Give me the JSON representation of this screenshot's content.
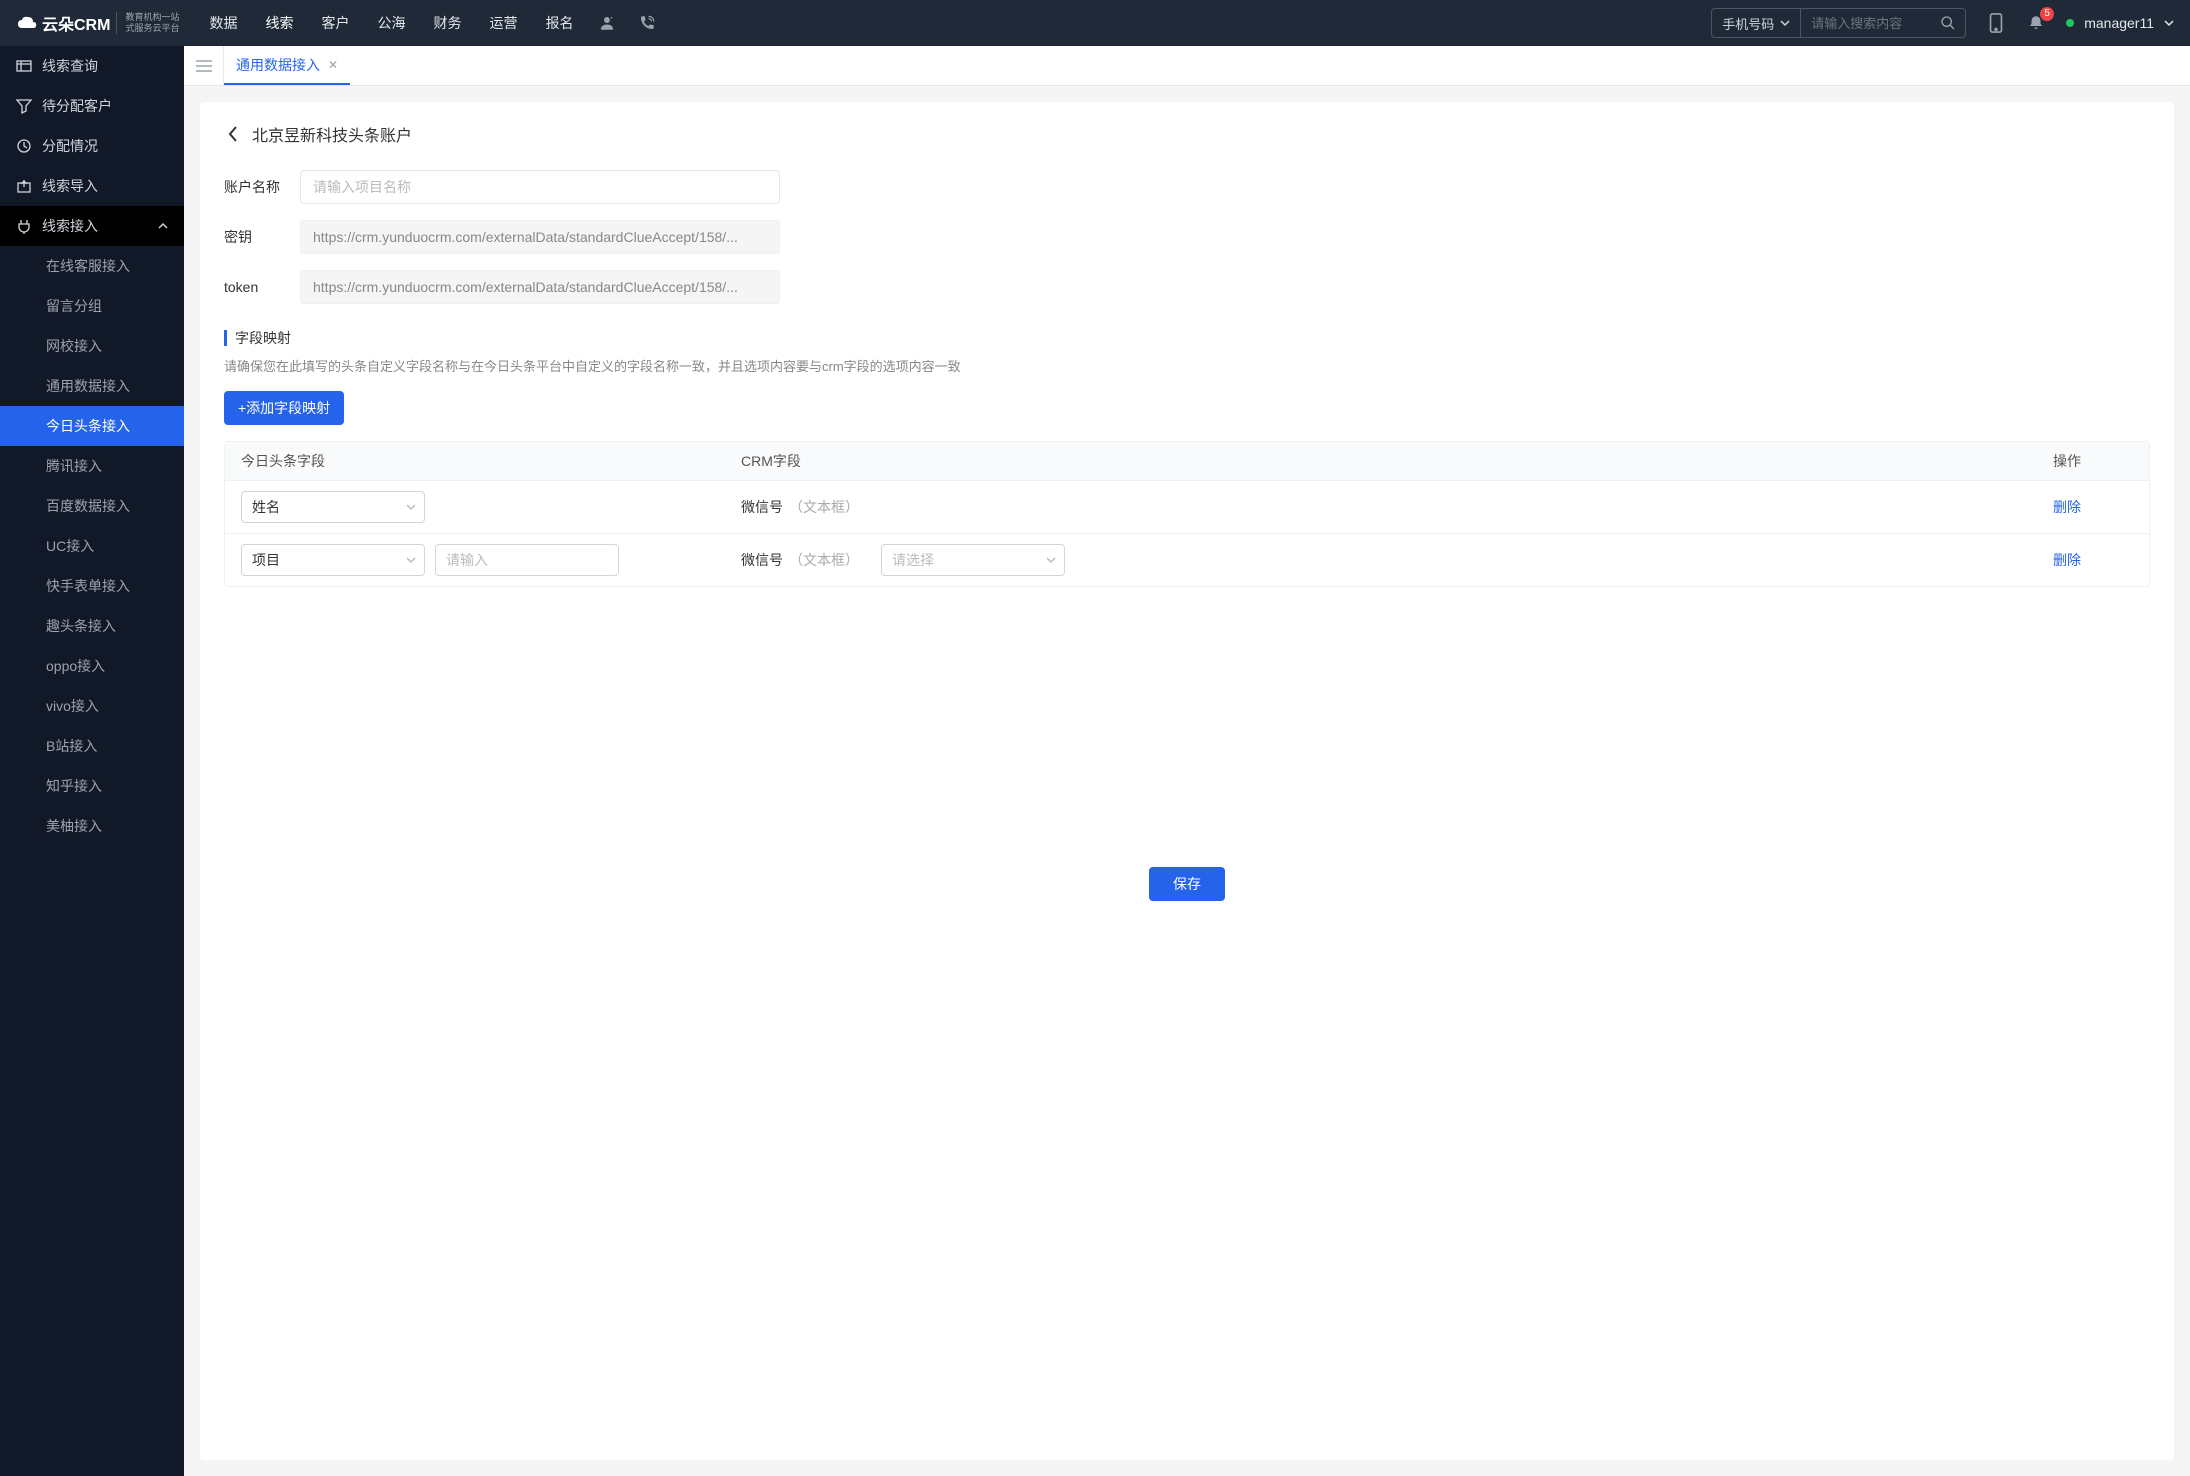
{
  "logo": {
    "brand": "云朵CRM",
    "sub_url": "www.yunduocrm.com",
    "sub1": "教育机构一站",
    "sub2": "式服务云平台"
  },
  "nav": [
    "数据",
    "线索",
    "客户",
    "公海",
    "财务",
    "运营",
    "报名"
  ],
  "nav_active": "线索",
  "search": {
    "type": "手机号码",
    "placeholder": "请输入搜索内容"
  },
  "notifications_badge": "5",
  "user": {
    "name": "manager11"
  },
  "sidebar": {
    "top": [
      {
        "label": "线索查询"
      },
      {
        "label": "待分配客户"
      },
      {
        "label": "分配情况"
      },
      {
        "label": "线索导入"
      }
    ],
    "integration": {
      "label": "线索接入",
      "items": [
        "在线客服接入",
        "留言分组",
        "网校接入",
        "通用数据接入",
        "今日头条接入",
        "腾讯接入",
        "百度数据接入",
        "UC接入",
        "快手表单接入",
        "趣头条接入",
        "oppo接入",
        "vivo接入",
        "B站接入",
        "知乎接入",
        "美柚接入"
      ],
      "active": "今日头条接入"
    }
  },
  "tabs": [
    {
      "label": "通用数据接入"
    }
  ],
  "page": {
    "title": "北京昱新科技头条账户",
    "form": {
      "account_label": "账户名称",
      "account_placeholder": "请输入项目名称",
      "account_value": "",
      "secret_label": "密钥",
      "secret_value": "https://crm.yunduocrm.com/externalData/standardClueAccept/158/...",
      "token_label": "token",
      "token_value": "https://crm.yunduocrm.com/externalData/standardClueAccept/158/..."
    },
    "mapping": {
      "title": "字段映射",
      "hint": "请确保您在此填写的头条自定义字段名称与在今日头条平台中自定义的字段名称一致，并且选项内容要与crm字段的选项内容一致",
      "add_btn": "+添加字段映射",
      "headers": {
        "h1": "今日头条字段",
        "h2": "CRM字段",
        "h3": "操作"
      },
      "rows": [
        {
          "tt_field": "姓名",
          "extra_input": false,
          "crm_main": "微信号",
          "crm_sub": "（文本框）",
          "crm_select": false,
          "del": "删除"
        },
        {
          "tt_field": "项目",
          "extra_input": true,
          "extra_placeholder": "请输入",
          "crm_main": "微信号",
          "crm_sub": "（文本框）",
          "crm_select": true,
          "crm_select_placeholder": "请选择",
          "del": "删除"
        }
      ]
    },
    "save_btn": "保存"
  }
}
